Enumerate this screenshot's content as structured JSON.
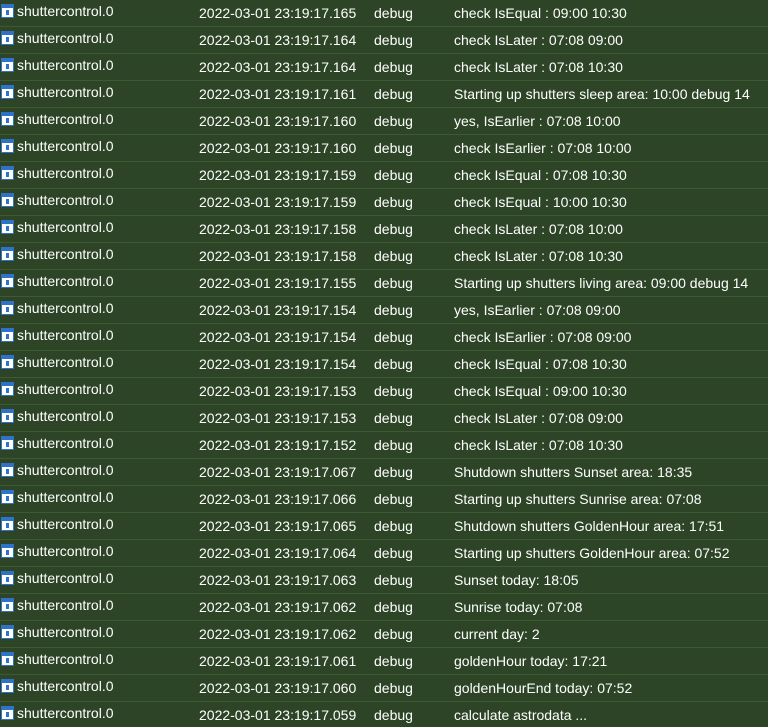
{
  "log": {
    "rows": [
      {
        "source": "shuttercontrol.0",
        "timestamp": "2022-03-01 23:19:17.165",
        "level": "debug",
        "message": "check IsEqual : 09:00 10:30"
      },
      {
        "source": "shuttercontrol.0",
        "timestamp": "2022-03-01 23:19:17.164",
        "level": "debug",
        "message": "check IsLater : 07:08 09:00"
      },
      {
        "source": "shuttercontrol.0",
        "timestamp": "2022-03-01 23:19:17.164",
        "level": "debug",
        "message": "check IsLater : 07:08 10:30"
      },
      {
        "source": "shuttercontrol.0",
        "timestamp": "2022-03-01 23:19:17.161",
        "level": "debug",
        "message": "Starting up shutters sleep area: 10:00 debug 14"
      },
      {
        "source": "shuttercontrol.0",
        "timestamp": "2022-03-01 23:19:17.160",
        "level": "debug",
        "message": "yes, IsEarlier : 07:08 10:00"
      },
      {
        "source": "shuttercontrol.0",
        "timestamp": "2022-03-01 23:19:17.160",
        "level": "debug",
        "message": "check IsEarlier : 07:08 10:00"
      },
      {
        "source": "shuttercontrol.0",
        "timestamp": "2022-03-01 23:19:17.159",
        "level": "debug",
        "message": "check IsEqual : 07:08 10:30"
      },
      {
        "source": "shuttercontrol.0",
        "timestamp": "2022-03-01 23:19:17.159",
        "level": "debug",
        "message": "check IsEqual : 10:00 10:30"
      },
      {
        "source": "shuttercontrol.0",
        "timestamp": "2022-03-01 23:19:17.158",
        "level": "debug",
        "message": "check IsLater : 07:08 10:00"
      },
      {
        "source": "shuttercontrol.0",
        "timestamp": "2022-03-01 23:19:17.158",
        "level": "debug",
        "message": "check IsLater : 07:08 10:30"
      },
      {
        "source": "shuttercontrol.0",
        "timestamp": "2022-03-01 23:19:17.155",
        "level": "debug",
        "message": "Starting up shutters living area: 09:00 debug 14"
      },
      {
        "source": "shuttercontrol.0",
        "timestamp": "2022-03-01 23:19:17.154",
        "level": "debug",
        "message": "yes, IsEarlier : 07:08 09:00"
      },
      {
        "source": "shuttercontrol.0",
        "timestamp": "2022-03-01 23:19:17.154",
        "level": "debug",
        "message": "check IsEarlier : 07:08 09:00"
      },
      {
        "source": "shuttercontrol.0",
        "timestamp": "2022-03-01 23:19:17.154",
        "level": "debug",
        "message": "check IsEqual : 07:08 10:30"
      },
      {
        "source": "shuttercontrol.0",
        "timestamp": "2022-03-01 23:19:17.153",
        "level": "debug",
        "message": "check IsEqual : 09:00 10:30"
      },
      {
        "source": "shuttercontrol.0",
        "timestamp": "2022-03-01 23:19:17.153",
        "level": "debug",
        "message": "check IsLater : 07:08 09:00"
      },
      {
        "source": "shuttercontrol.0",
        "timestamp": "2022-03-01 23:19:17.152",
        "level": "debug",
        "message": "check IsLater : 07:08 10:30"
      },
      {
        "source": "shuttercontrol.0",
        "timestamp": "2022-03-01 23:19:17.067",
        "level": "debug",
        "message": "Shutdown shutters Sunset area: 18:35"
      },
      {
        "source": "shuttercontrol.0",
        "timestamp": "2022-03-01 23:19:17.066",
        "level": "debug",
        "message": "Starting up shutters Sunrise area: 07:08"
      },
      {
        "source": "shuttercontrol.0",
        "timestamp": "2022-03-01 23:19:17.065",
        "level": "debug",
        "message": "Shutdown shutters GoldenHour area: 17:51"
      },
      {
        "source": "shuttercontrol.0",
        "timestamp": "2022-03-01 23:19:17.064",
        "level": "debug",
        "message": "Starting up shutters GoldenHour area: 07:52"
      },
      {
        "source": "shuttercontrol.0",
        "timestamp": "2022-03-01 23:19:17.063",
        "level": "debug",
        "message": "Sunset today: 18:05"
      },
      {
        "source": "shuttercontrol.0",
        "timestamp": "2022-03-01 23:19:17.062",
        "level": "debug",
        "message": "Sunrise today: 07:08"
      },
      {
        "source": "shuttercontrol.0",
        "timestamp": "2022-03-01 23:19:17.062",
        "level": "debug",
        "message": "current day: 2"
      },
      {
        "source": "shuttercontrol.0",
        "timestamp": "2022-03-01 23:19:17.061",
        "level": "debug",
        "message": "goldenHour today: 17:21"
      },
      {
        "source": "shuttercontrol.0",
        "timestamp": "2022-03-01 23:19:17.060",
        "level": "debug",
        "message": "goldenHourEnd today: 07:52"
      },
      {
        "source": "shuttercontrol.0",
        "timestamp": "2022-03-01 23:19:17.059",
        "level": "debug",
        "message": "calculate astrodata ..."
      }
    ]
  }
}
